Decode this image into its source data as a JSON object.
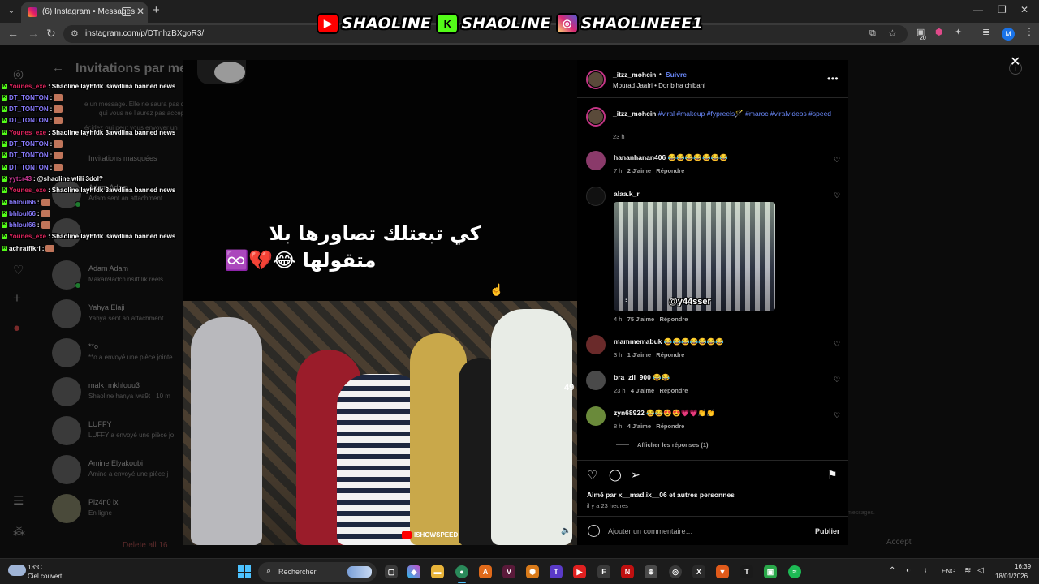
{
  "browser": {
    "tab_title": "(6) Instagram • Messages",
    "url": "instagram.com/p/DTnhzBXgoR3/",
    "extension_badge": "20",
    "profile_initial": "M"
  },
  "overlay": {
    "youtube_name": "SHAOLINE",
    "kick_name": "SHAOLINE",
    "instagram_name": "SHAOLINEEE1"
  },
  "background": {
    "title": "Invitations par me",
    "note_1": "e un message. Elle ne saura pas qu",
    "note_2": "qui vous ne l'aurez pas accepté.",
    "note_3": "écidez qui peut vous envoyer un",
    "hidden_invites": "Invitations masquées",
    "threads": [
      {
        "name": "Adam Adam",
        "sub": "Adam sent an attachment."
      },
      {
        "name": "",
        "sub": ""
      },
      {
        "name": "Adam Adam",
        "sub": "Makan9adch nsift lik reels"
      },
      {
        "name": "Yahya Elaji",
        "sub": "Yahya sent an attachment."
      },
      {
        "name": "**o",
        "sub": "**o a envoyé une pièce jointe"
      },
      {
        "name": "malk_mkhlouu3",
        "sub": "Shaoline hanya lwa9t · 10 m"
      },
      {
        "name": "LUFFY",
        "sub": "LUFFY a envoyé une pièce jo"
      },
      {
        "name": "Amine Elyakoubi",
        "sub": "Amine a envoyé une pièce j"
      },
      {
        "name": "Piz4n0 lx",
        "sub": "En ligne"
      }
    ],
    "delete_all": "Delete all 16",
    "accept": "Accept",
    "messages_note": "messages."
  },
  "chat": [
    {
      "user": "Younes_exe",
      "color": "#e0245e",
      "text": "Shaoline layhfdk 3awdlina banned news",
      "emote": false
    },
    {
      "user": "DT_TONTON",
      "color": "#8a7cff",
      "text": "",
      "emote": true
    },
    {
      "user": "DT_TONTON",
      "color": "#8a7cff",
      "text": "",
      "emote": true
    },
    {
      "user": "DT_TONTON",
      "color": "#8a7cff",
      "text": "",
      "emote": true
    },
    {
      "user": "Younes_exe",
      "color": "#e0245e",
      "text": "Shaoline layhfdk 3awdlina banned news",
      "emote": false
    },
    {
      "user": "DT_TONTON",
      "color": "#8a7cff",
      "text": "",
      "emote": true
    },
    {
      "user": "DT_TONTON",
      "color": "#8a7cff",
      "text": "",
      "emote": true
    },
    {
      "user": "DT_TONTON",
      "color": "#8a7cff",
      "text": "",
      "emote": true
    },
    {
      "user": "yytcr43",
      "color": "#d13b9a",
      "text": "@shaoline wlili 3dol?",
      "emote": false
    },
    {
      "user": "Younes_exe",
      "color": "#e0245e",
      "text": "Shaoline layhfdk 3awdlina banned news",
      "emote": false
    },
    {
      "user": "bhloul66",
      "color": "#8a7cff",
      "text": "",
      "emote": true
    },
    {
      "user": "bhloul66",
      "color": "#8a7cff",
      "text": "",
      "emote": true
    },
    {
      "user": "bhloul66",
      "color": "#8a7cff",
      "text": "",
      "emote": true
    },
    {
      "user": "Younes_exe",
      "color": "#e0245e",
      "text": "Shaoline layhfdk 3awdlina banned news",
      "emote": false
    },
    {
      "user": "achraffikri",
      "color": "#ffffff",
      "text": "",
      "emote": true
    }
  ],
  "post": {
    "caption_line1": "كي تبعتلك تصاورها بلا",
    "caption_line2": "متقولها 😂💔♾️",
    "counter": "49",
    "watermark": "ISHOWSPEED",
    "author": "_itzz_mohcin",
    "follow": "Suivre",
    "audio": "Mourad Jaafri • Dor biha chibani",
    "caption_user": "_itzz_mohcin",
    "caption_tags": "#viral #makeup #fypreels🪄 #maroc #viralvideos #speed",
    "caption_time": "23 h",
    "comments": [
      {
        "user": "hananhanan406",
        "text": "😂😂😂😂😂😂😂",
        "time": "7 h",
        "likes": "2 J'aime",
        "reply": "Répondre",
        "avatar": "#8a3a6a"
      },
      {
        "user": "alaa.k_r",
        "text": "",
        "time": "4 h",
        "likes": "75 J'aime",
        "reply": "Répondre",
        "avatar": "#111111",
        "image_tag": "@y44sser"
      },
      {
        "user": "mammemabuk",
        "text": "😂😂😂😂😂😂😂",
        "time": "3 h",
        "likes": "1 J'aime",
        "reply": "Répondre",
        "avatar": "#6a2a2a"
      },
      {
        "user": "bra_zil_900",
        "text": "😂😂",
        "time": "23 h",
        "likes": "4 J'aime",
        "reply": "Répondre",
        "avatar": "#4a4a4a"
      },
      {
        "user": "zyn68922",
        "text": "😂😂😍😍💗💗👏👏",
        "time": "8 h",
        "likes": "4 J'aime",
        "reply": "Répondre",
        "avatar": "#6a8a3a"
      }
    ],
    "show_replies": "Afficher les réponses (1)",
    "liked_by": "Aimé par x__mad.ix__06 et autres personnes",
    "posted": "il y a 23 heures",
    "comment_placeholder": "Ajouter un commentaire…",
    "publish": "Publier"
  },
  "taskbar": {
    "temperature": "13°C",
    "weather": "Ciel couvert",
    "search": "Rechercher",
    "language": "ENG",
    "time": "16:39",
    "date": "18/01/2026"
  }
}
